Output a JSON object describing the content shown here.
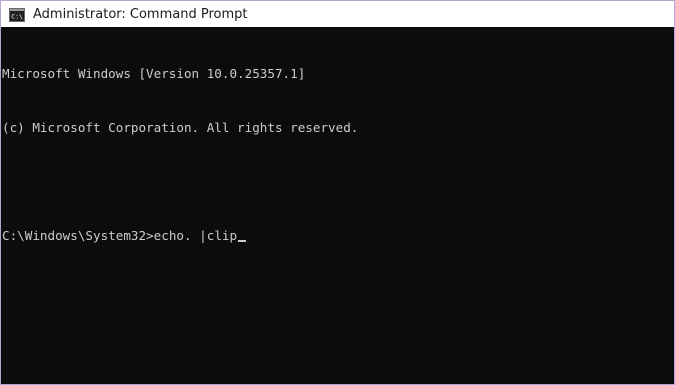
{
  "window": {
    "title": "Administrator: Command Prompt",
    "icon": "cmd-console-icon"
  },
  "console": {
    "lines": [
      "Microsoft Windows [Version 10.0.25357.1]",
      "(c) Microsoft Corporation. All rights reserved.",
      "",
      "C:\\Windows\\System32>echo. |clip"
    ],
    "prompt": "C:\\Windows\\System32>",
    "command": "echo. |clip"
  },
  "colors": {
    "background": "#0c0c0c",
    "foreground": "#cccccc",
    "titlebar": "#ffffff",
    "window_border": "#b9a3d6"
  }
}
